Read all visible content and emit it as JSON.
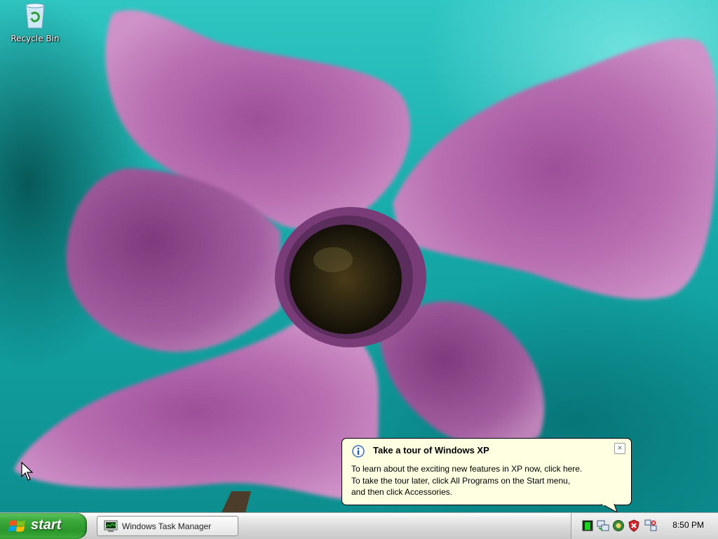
{
  "desktop": {
    "icons": [
      {
        "label": "Recycle Bin",
        "icon": "recycle-bin-icon"
      }
    ]
  },
  "balloon": {
    "icon": "info-icon",
    "title": "Take a tour of Windows XP",
    "close_symbol": "×",
    "lines": [
      "To learn about the exciting new features in XP now, click here.",
      "To take the tour later, click All Programs on the Start menu,",
      "and then click Accessories."
    ]
  },
  "taskbar": {
    "start_label": "start",
    "tasks": [
      {
        "label": "Windows Task Manager",
        "icon": "task-manager-icon"
      }
    ],
    "tray": {
      "icons": [
        "cpu-usage-icon",
        "network-icon",
        "tour-icon",
        "security-center-icon",
        "network-connection-icon"
      ],
      "clock": "8:50 PM"
    }
  },
  "colors": {
    "start_green": "#3aa93a",
    "balloon_bg": "#ffffe1",
    "wallpaper_teal": "#1fb3b0",
    "petal": "#b86fb1"
  }
}
